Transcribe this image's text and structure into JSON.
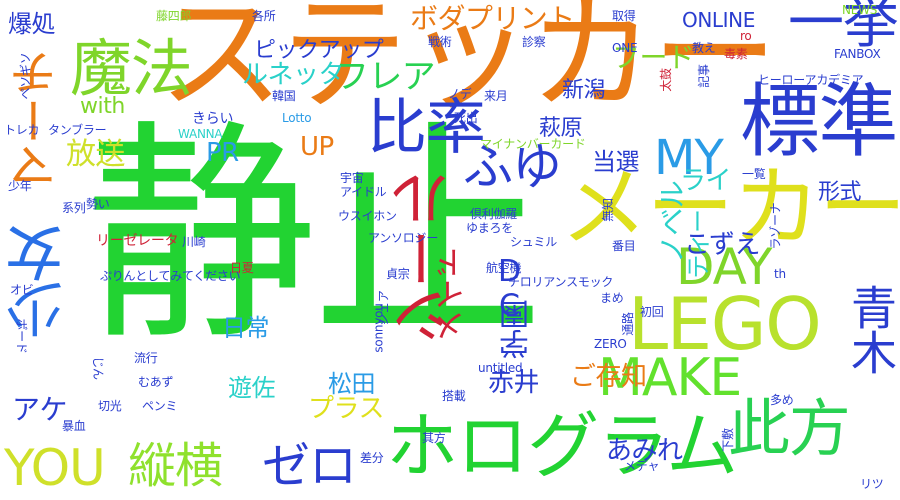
{
  "words": [
    {
      "text": "静止",
      "color": "#22d332"
    },
    {
      "text": "ステッカー",
      "color": "#ea7b16"
    },
    {
      "text": "メーカー",
      "color": "#dfe01c"
    },
    {
      "text": "ホログラム",
      "color": "#22d332"
    },
    {
      "text": "標準",
      "color": "#2a3dcf"
    },
    {
      "text": "LEGO",
      "color": "#b8e12d"
    },
    {
      "text": "比率",
      "color": "#2a3dcf"
    },
    {
      "text": "魔法",
      "color": "#7fd52a"
    },
    {
      "text": "少女",
      "color": "#2a70e6"
    },
    {
      "text": "一挙",
      "color": "#2a3dcf"
    },
    {
      "text": "シール",
      "color": "#cf2237"
    },
    {
      "text": "此方",
      "color": "#28d152"
    },
    {
      "text": "ゼロ",
      "color": "#2a3dcf"
    },
    {
      "text": "縦横",
      "color": "#8fe12d"
    },
    {
      "text": "YOU",
      "color": "#cfe02a"
    },
    {
      "text": "MAKE",
      "color": "#62e12d"
    },
    {
      "text": "DAY",
      "color": "#7fd52a"
    },
    {
      "text": "MY",
      "color": "#2a9be6"
    },
    {
      "text": "青木",
      "color": "#2a3dcf"
    },
    {
      "text": "マーチ",
      "color": "#ea7b16"
    },
    {
      "text": "ふゆ",
      "color": "#2a3dcf"
    },
    {
      "text": "学園",
      "color": "#2a3dcf"
    },
    {
      "text": "DC",
      "color": "#2a3dcf"
    },
    {
      "text": "メイド",
      "color": "#cf2237"
    },
    {
      "text": "フレア",
      "color": "#28d152"
    },
    {
      "text": "ルネッタ",
      "color": "#2ad1c9"
    },
    {
      "text": "ボダプリント",
      "color": "#ea7b16"
    },
    {
      "text": "ピックアップ",
      "color": "#2a3dcf"
    },
    {
      "text": "フード",
      "color": "#7fd52a"
    },
    {
      "text": "ONLINE",
      "color": "#2a3dcf"
    },
    {
      "text": "ノベル",
      "color": "#2ad1c9"
    },
    {
      "text": "ティー",
      "color": "#2ad1c9"
    },
    {
      "text": "ライ",
      "color": "#2ad1c9"
    },
    {
      "text": "形式",
      "color": "#2a3dcf"
    },
    {
      "text": "こずえ",
      "color": "#2a3dcf"
    },
    {
      "text": "当選",
      "color": "#2a3dcf"
    },
    {
      "text": "新潟",
      "color": "#2a3dcf"
    },
    {
      "text": "萩原",
      "color": "#2a3dcf"
    },
    {
      "text": "UP",
      "color": "#ea7b16"
    },
    {
      "text": "PR",
      "color": "#2a9be6"
    },
    {
      "text": "放送",
      "color": "#cfe02a"
    },
    {
      "text": "with",
      "color": "#7fd52a"
    },
    {
      "text": "日常",
      "color": "#2a9be6"
    },
    {
      "text": "遊佐",
      "color": "#2ad1c9"
    },
    {
      "text": "アケ",
      "color": "#2a3dcf"
    },
    {
      "text": "松田",
      "color": "#2a9be6"
    },
    {
      "text": "プラス",
      "color": "#dfe01c"
    },
    {
      "text": "赤井",
      "color": "#2a3dcf"
    },
    {
      "text": "ご存知",
      "color": "#ea7b16"
    },
    {
      "text": "あみれ",
      "color": "#2a3dcf"
    },
    {
      "text": "爆処",
      "color": "#2a3dcf"
    },
    {
      "text": "藤四郎",
      "color": "#7fd52a"
    },
    {
      "text": "各所",
      "color": "#2a3dcf"
    },
    {
      "text": "ヒーローアカデミア",
      "color": "#2a3dcf"
    },
    {
      "text": "マイナンバーカード",
      "color": "#7fd52a"
    },
    {
      "text": "タンブラー",
      "color": "#2a3dcf"
    },
    {
      "text": "きらい",
      "color": "#2a3dcf"
    },
    {
      "text": "WANNA",
      "color": "#2ad1c9"
    },
    {
      "text": "Lotto",
      "color": "#2a9be6"
    },
    {
      "text": "韓国",
      "color": "#2a3dcf"
    },
    {
      "text": "死出",
      "color": "#2a3dcf"
    },
    {
      "text": "来月",
      "color": "#2a3dcf"
    },
    {
      "text": "診察",
      "color": "#2a3dcf"
    },
    {
      "text": "取得",
      "color": "#2a3dcf"
    },
    {
      "text": "戦術",
      "color": "#2a3dcf"
    },
    {
      "text": "NEWS",
      "color": "#7fd52a"
    },
    {
      "text": "FANBOX",
      "color": "#2a3dcf"
    },
    {
      "text": "ONE",
      "color": "#2a3dcf"
    },
    {
      "text": "ro",
      "color": "#cf2237"
    },
    {
      "text": "教え",
      "color": "#2a3dcf"
    },
    {
      "text": "記事",
      "color": "#2a3dcf"
    },
    {
      "text": "毒素",
      "color": "#cf2237"
    },
    {
      "text": "太鼓",
      "color": "#cf2237"
    },
    {
      "text": "ペソギソ",
      "color": "#2a3dcf"
    },
    {
      "text": "トレカ",
      "color": "#2a3dcf"
    },
    {
      "text": "少年",
      "color": "#2a3dcf"
    },
    {
      "text": "系列",
      "color": "#2a3dcf"
    },
    {
      "text": "勢い",
      "color": "#2a3dcf"
    },
    {
      "text": "リーゼレータ",
      "color": "#cf2237"
    },
    {
      "text": "川崎",
      "color": "#2a3dcf"
    },
    {
      "text": "日夏",
      "color": "#cf2237"
    },
    {
      "text": "ぷりんとしてみてください",
      "color": "#2a3dcf"
    },
    {
      "text": "オビ",
      "color": "#2a3dcf"
    },
    {
      "text": "ボード",
      "color": "#2a3dcf"
    },
    {
      "text": "じん",
      "color": "#2a3dcf"
    },
    {
      "text": "流行",
      "color": "#2a3dcf"
    },
    {
      "text": "むあず",
      "color": "#2a3dcf"
    },
    {
      "text": "ペンミ",
      "color": "#2a3dcf"
    },
    {
      "text": "切光",
      "color": "#2a3dcf"
    },
    {
      "text": "暴血",
      "color": "#2a3dcf"
    },
    {
      "text": "宇宙",
      "color": "#2a3dcf"
    },
    {
      "text": "アイドル",
      "color": "#2a3dcf"
    },
    {
      "text": "ウスイホン",
      "color": "#2a3dcf"
    },
    {
      "text": "倶利伽羅",
      "color": "#2a3dcf"
    },
    {
      "text": "ゆまろを",
      "color": "#2a3dcf"
    },
    {
      "text": "アンソロジー",
      "color": "#2a3dcf"
    },
    {
      "text": "シュミル",
      "color": "#2a3dcf"
    },
    {
      "text": "貞宗",
      "color": "#2a3dcf"
    },
    {
      "text": "航空機",
      "color": "#2a3dcf"
    },
    {
      "text": "チロリアンスモック",
      "color": "#2a3dcf"
    },
    {
      "text": "シェア",
      "color": "#2a3dcf"
    },
    {
      "text": "sonnyou",
      "color": "#2a3dcf"
    },
    {
      "text": "untitled",
      "color": "#2a3dcf"
    },
    {
      "text": "搭載",
      "color": "#2a3dcf"
    },
    {
      "text": "其方",
      "color": "#2a3dcf"
    },
    {
      "text": "差分",
      "color": "#2a3dcf"
    },
    {
      "text": "ZERO",
      "color": "#2a3dcf"
    },
    {
      "text": "まめ",
      "color": "#2a3dcf"
    },
    {
      "text": "初回",
      "color": "#2a3dcf"
    },
    {
      "text": "通路",
      "color": "#2a3dcf"
    },
    {
      "text": "番目",
      "color": "#2a3dcf"
    },
    {
      "text": "ラゾーナ",
      "color": "#2a3dcf"
    },
    {
      "text": "無知",
      "color": "#2a3dcf"
    },
    {
      "text": "一覧",
      "color": "#2a3dcf"
    },
    {
      "text": "ノデ",
      "color": "#2a3dcf"
    },
    {
      "text": "th",
      "color": "#2a3dcf"
    },
    {
      "text": "多め",
      "color": "#2a3dcf"
    },
    {
      "text": "下敷",
      "color": "#2a3dcf"
    },
    {
      "text": "メデャ",
      "color": "#2a3dcf"
    },
    {
      "text": "リツ",
      "color": "#2a3dcf"
    }
  ]
}
